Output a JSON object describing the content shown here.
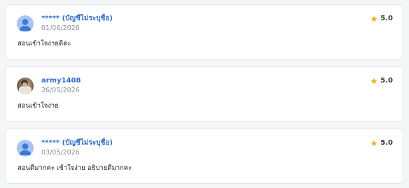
{
  "reviews": [
    {
      "reviewer": "***** (บัญชีไม่ระบุชื่อ)",
      "date": "01/06/2026",
      "rating": "5.0",
      "comment": "สอนเข้าใจง่ายดีคะ",
      "avatar_icon": "default-user-icon"
    },
    {
      "reviewer": "army1408",
      "date": "26/05/2026",
      "rating": "5.0",
      "comment": "สอนเข้าใจง่าย",
      "avatar_icon": "user-photo"
    },
    {
      "reviewer": "***** (บัญชีไม่ระบุชื่อ)",
      "date": "03/05/2026",
      "rating": "5.0",
      "comment": "สอนดีมากคะ เข้าใจง่าย อธิบายดีมากคะ",
      "avatar_icon": "default-user-icon"
    }
  ],
  "colors": {
    "name": "#2d6cd6",
    "star": "#f5b21b",
    "avatar_bg": "#a8c4f3",
    "avatar_fg": "#3c78d8"
  }
}
